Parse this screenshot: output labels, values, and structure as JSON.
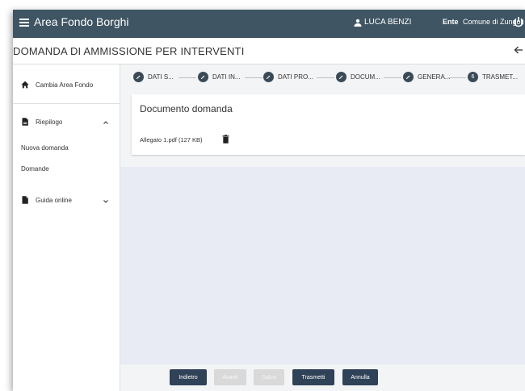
{
  "header": {
    "app_title": "Area Fondo Borghi",
    "user_name": "LUCA BENZI",
    "ente_label": "Ente",
    "ente_value": "Comune di Zungoli"
  },
  "page": {
    "title": "DOMANDA DI AMMISSIONE PER INTERVENTI"
  },
  "sidebar": {
    "change_area": "Cambia Area Fondo",
    "riepilogo": "Riepilogo",
    "nuova_domanda": "Nuova domanda",
    "domande": "Domande",
    "guida_online": "Guida online"
  },
  "stepper": {
    "steps": [
      {
        "label": "DATI S...",
        "icon": "pencil-icon"
      },
      {
        "label": "DATI IN...",
        "icon": "pencil-icon"
      },
      {
        "label": "DATI PRO...",
        "icon": "pencil-icon"
      },
      {
        "label": "DOCUM...",
        "icon": "pencil-icon"
      },
      {
        "label": "GENERA...",
        "icon": "pencil-icon"
      },
      {
        "label": "TRASMET...",
        "number": "6"
      }
    ]
  },
  "card": {
    "title": "Documento domanda",
    "file": "Allegato 1.pdf (127 KB)"
  },
  "footer": {
    "indietro": "Indietro",
    "avanti": "Avanti",
    "salva": "Salva",
    "trasmetti": "Trasmetti",
    "annulla": "Annulla"
  },
  "colors": {
    "topbar": "#3f5563",
    "primary_button": "#2f4257",
    "content_bg": "#e8eaf4"
  }
}
